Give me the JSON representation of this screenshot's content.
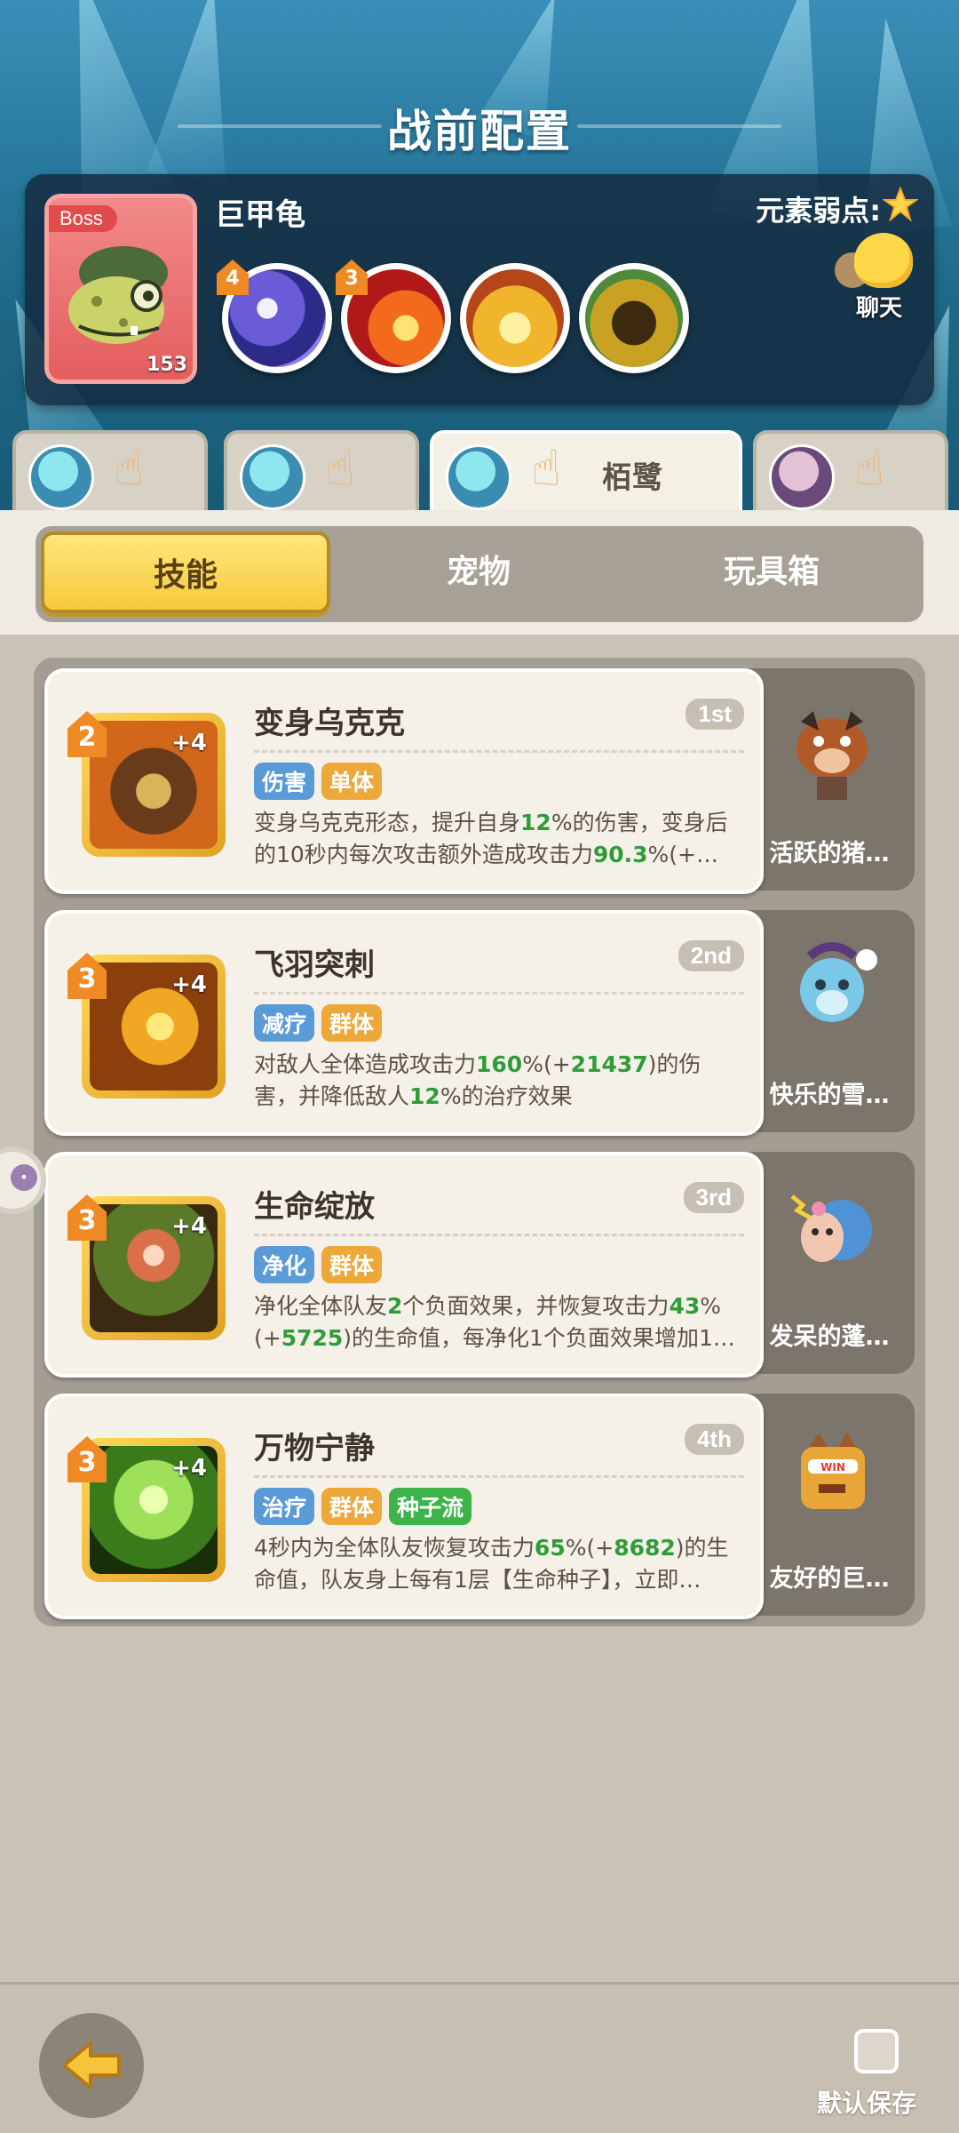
{
  "header": {
    "title": "战前配置"
  },
  "boss": {
    "tag": "Boss",
    "name": "巨甲龟",
    "level": "153",
    "weakness_label": "元素弱点:",
    "weakness_icon": "star-icon",
    "skills": [
      {
        "level": "4",
        "icon": "vortex-skill-icon"
      },
      {
        "level": "3",
        "icon": "fire-slash-skill-icon"
      },
      {
        "level": "",
        "icon": "crown-spike-skill-icon"
      },
      {
        "level": "",
        "icon": "dark-beast-skill-icon"
      }
    ]
  },
  "chat": {
    "label": "聊天"
  },
  "heroes": [
    {
      "name": "",
      "active": false
    },
    {
      "name": "",
      "active": false
    },
    {
      "name": "栢鹭",
      "active": true
    },
    {
      "name": "",
      "active": false
    }
  ],
  "tabs": [
    {
      "label": "技能",
      "active": true
    },
    {
      "label": "宠物",
      "active": false
    },
    {
      "label": "玩具箱",
      "active": false
    }
  ],
  "skills": [
    {
      "name": "变身乌克克",
      "rank": "1st",
      "level": "2",
      "plus": "+4",
      "tags": [
        {
          "label": "伤害",
          "color": "blue"
        },
        {
          "label": "单体",
          "color": "orange"
        }
      ],
      "desc_parts": [
        "变身乌克克形态，提升自身",
        "12",
        "%的伤害，变身后的10秒内每次攻击额外造成攻击力",
        "90.3",
        "%(+…"
      ],
      "pet": "活跃的猪…"
    },
    {
      "name": "飞羽突刺",
      "rank": "2nd",
      "level": "3",
      "plus": "+4",
      "tags": [
        {
          "label": "减疗",
          "color": "blue"
        },
        {
          "label": "群体",
          "color": "orange"
        }
      ],
      "desc_parts": [
        "对敌人全体造成攻击力",
        "160",
        "%(+",
        "21437",
        ")的伤害，并降低敌人",
        "12",
        "%的治疗效果"
      ],
      "pet": "快乐的雪…"
    },
    {
      "name": "生命绽放",
      "rank": "3rd",
      "level": "3",
      "plus": "+4",
      "tags": [
        {
          "label": "净化",
          "color": "blue"
        },
        {
          "label": "群体",
          "color": "orange"
        }
      ],
      "desc_parts": [
        "净化全体队友",
        "2",
        "个负面效果，并恢复攻击力",
        "43",
        "%(+",
        "5725",
        ")的生命值，每净化1个负面效果增加1…"
      ],
      "pet": "发呆的蓬…"
    },
    {
      "name": "万物宁静",
      "rank": "4th",
      "level": "3",
      "plus": "+4",
      "tags": [
        {
          "label": "治疗",
          "color": "blue"
        },
        {
          "label": "群体",
          "color": "orange"
        },
        {
          "label": "种子流",
          "color": "green"
        }
      ],
      "desc_parts": [
        "4秒内为全体队友恢复攻击力",
        "65",
        "%(+",
        "8682",
        ")的生命值，队友身上每有1层【生命种子】，立即…"
      ],
      "pet": "友好的巨…"
    }
  ],
  "footer": {
    "save_label": "默认保存",
    "back_icon": "back-arrow-icon"
  }
}
